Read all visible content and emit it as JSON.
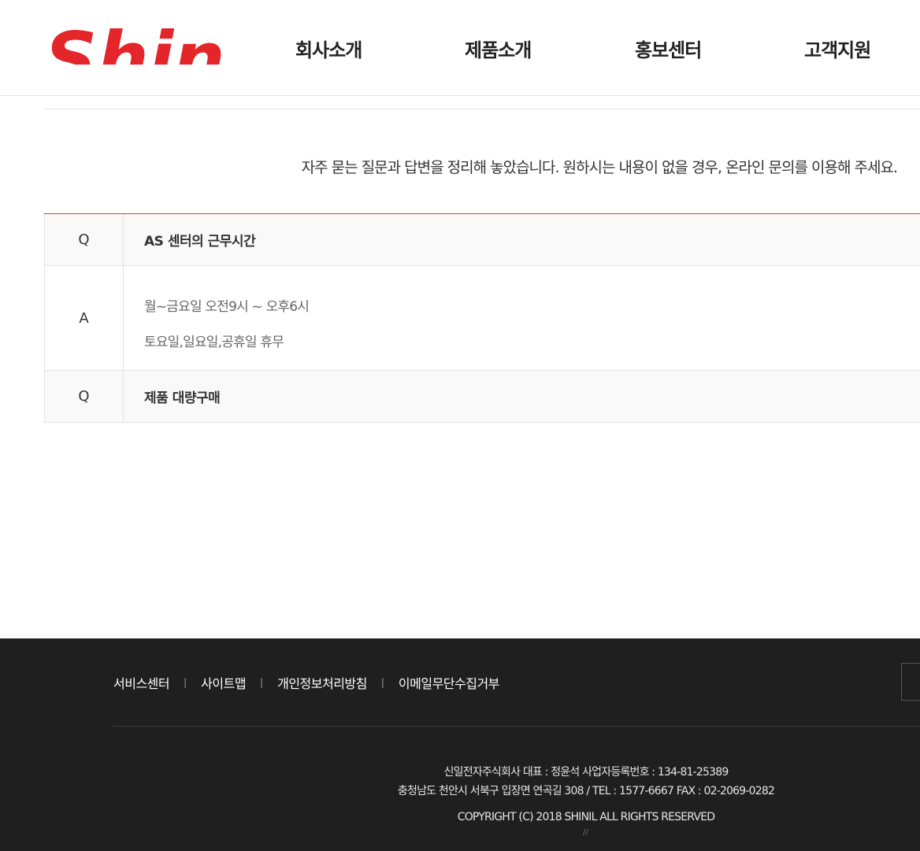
{
  "header": {
    "logo_text": "Shinil",
    "nav": [
      {
        "label": "회사소개"
      },
      {
        "label": "제품소개"
      },
      {
        "label": "홍보센터"
      },
      {
        "label": "고객지원"
      }
    ]
  },
  "colors": {
    "brand_red": "#e4262b",
    "accent_line": "#b94a4a",
    "footer_bg": "#1f1f1f"
  },
  "intro": "자주 묻는 질문과 답변을 정리해 놓았습니다. 원하시는 내용이 없을 경우, 온라인 문의를 이용해 주세요.",
  "faq": {
    "items": [
      {
        "q_label": "Q",
        "question": "AS 센터의 근무시간",
        "a_label": "A",
        "answer_lines": [
          "월~금요일 오전9시 ~ 오후6시",
          "토요일,일요일,공휴일 휴무"
        ]
      },
      {
        "q_label": "Q",
        "question": "제품 대량구매"
      }
    ]
  },
  "footer": {
    "links": [
      {
        "label": "서비스센터"
      },
      {
        "label": "사이트맵"
      },
      {
        "label": "개인정보처리방침"
      },
      {
        "label": "이메일무단수집거부"
      }
    ],
    "separator": "|",
    "info_line1": "신일전자주식회사 대표 : 정윤석 사업자등록번호 : 134-81-25389",
    "info_line2": "충청남도 천안시 서북구 입장면 연곡길 308 / TEL : 1577-6667 FAX : 02-2069-0282",
    "copyright": "COPYRIGHT (C) 2018 SHINIL ALL RIGHTS RESERVED",
    "mark": "//"
  }
}
